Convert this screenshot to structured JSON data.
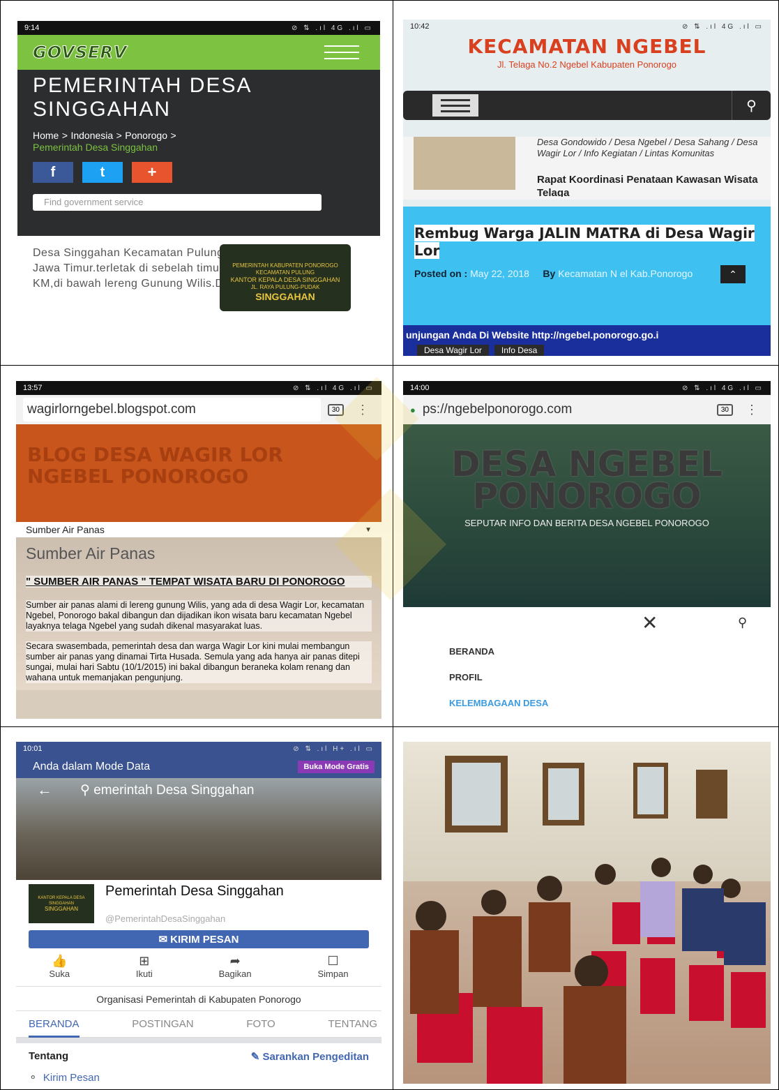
{
  "p1": {
    "time": "9:14",
    "status": "⊘ ⇅ .ıl 4G .ıl ▭",
    "logo": "GOVSERV",
    "title": "PEMERINTAH DESA SINGGAHAN",
    "crumbs": [
      "Home",
      "Indonesia",
      "Ponorogo"
    ],
    "crumb_sep": ">",
    "crumb_active": "Pemerintah Desa Singgahan",
    "share": [
      "f",
      "t",
      "+"
    ],
    "search_placeholder": "Find government service",
    "body": "Desa Singgahan Kecamatan Pulung Kabupaten Ponorogo Jawa Timur.terletak di sebelah timur kota ponorogo +_ 25 KM,di bawah lereng Gunung Wilis.Dengan Panorama Alam",
    "sign_1": "PEMERINTAH KABUPATEN PONOROGO",
    "sign_2": "KECAMATAN PULUNG",
    "sign_3": "KANTOR KEPALA DESA SINGGAHAN",
    "sign_4": "JL. RAYA PULUNG-PUDAK",
    "sign_5": "SINGGAHAN"
  },
  "p2": {
    "time": "10:42",
    "status": "⊘ ⇅ .ıl 4G .ıl ▭",
    "title": "KECAMATAN NGEBEL",
    "subtitle": "Jl. Telaga No.2 Ngebel Kabupaten Ponorogo",
    "cats": "Desa Gondowido / Desa Ngebel / Desa Sahang / Desa Wagir Lor / Info Kegiatan / Lintas Komunitas",
    "post_title": "Rapat Koordinasi Penataan Kawasan Wisata Telaga",
    "headline": "Rembug Warga JALIN MATRA di Desa Wagir Lor",
    "posted_label": "Posted on :",
    "posted_date": "May 22, 2018",
    "by_label": "By",
    "author": "Kecamatan N  el Kab.Ponorogo",
    "ticker": "unjungan Anda Di Website http://ngebel.ponorogo.go.i",
    "tags": [
      "Desa Wagir Lor",
      "Info Desa"
    ]
  },
  "p3": {
    "time": "13:57",
    "status": "⊘ ⇅ .ıl 4G .ıl ▭",
    "url": "wagirlorngebel.blogspot.com",
    "tabs": "30",
    "blog_title": "BLOG DESA WAGIR LOR NGEBEL PONOROGO",
    "dropdown": "Sumber Air Panas",
    "page_title": "Sumber Air Panas",
    "headline": "\" SUMBER AIR PANAS \" TEMPAT WISATA BARU DI PONOROGO",
    "para1": "Sumber air panas alami di lereng gunung Wilis, yang ada di desa Wagir Lor, kecamatan Ngebel, Ponorogo bakal dibangun dan dijadikan ikon wisata baru kecamatan Ngebel layaknya telaga Ngebel yang sudah dikenal masyarakat luas.",
    "para2": "Secara swasembada, pemerintah desa dan warga Wagir Lor kini mulai membangun sumber air panas yang dinamai Tirta Husada. Semula yang ada hanya air panas ditepi sungai, mulai hari Sabtu (10/1/2015) ini bakal dibangun beraneka kolam renang dan wahana untuk memanjakan pengunjung."
  },
  "p4": {
    "time": "14:00",
    "status": "⊘ ⇅ .ıl 4G .ıl ▭",
    "url": "ps://ngebelponorogo.com",
    "tabs": "30",
    "hero_title": "DESA NGEBEL PONOROGO",
    "hero_sub": "SEPUTAR INFO DAN BERITA DESA NGEBEL PONOROGO",
    "menu": [
      "BERANDA",
      "PROFIL",
      "KELEMBAGAAN DESA"
    ]
  },
  "p5": {
    "time": "10:01",
    "status": "⊘ ⇅ .ıl H+ .ıl ▭",
    "mode": "Anda dalam Mode Data",
    "mode_btn": "Buka Mode Gratis",
    "search": "emerintah Desa Singgahan",
    "page_name": "Pemerintah Desa Singgahan",
    "handle": "@PemerintahDesaSinggahan",
    "msg_btn": "KIRIM PESAN",
    "actions": [
      "Suka",
      "Ikuti",
      "Bagikan",
      "Simpan"
    ],
    "category": "Organisasi Pemerintah di Kabupaten Ponorogo",
    "tabs": [
      "BERANDA",
      "POSTINGAN",
      "FOTO",
      "TENTANG"
    ],
    "about": "Tentang",
    "suggest": "Sarankan Pengeditan",
    "kirim": "Kirim Pesan"
  },
  "colors": {
    "fb_blue": "#4267b2",
    "gov_green": "#7dc241",
    "ngebel_red": "#d9401f",
    "blog_orange": "#c8561c",
    "link_blue": "#3b9be0"
  }
}
